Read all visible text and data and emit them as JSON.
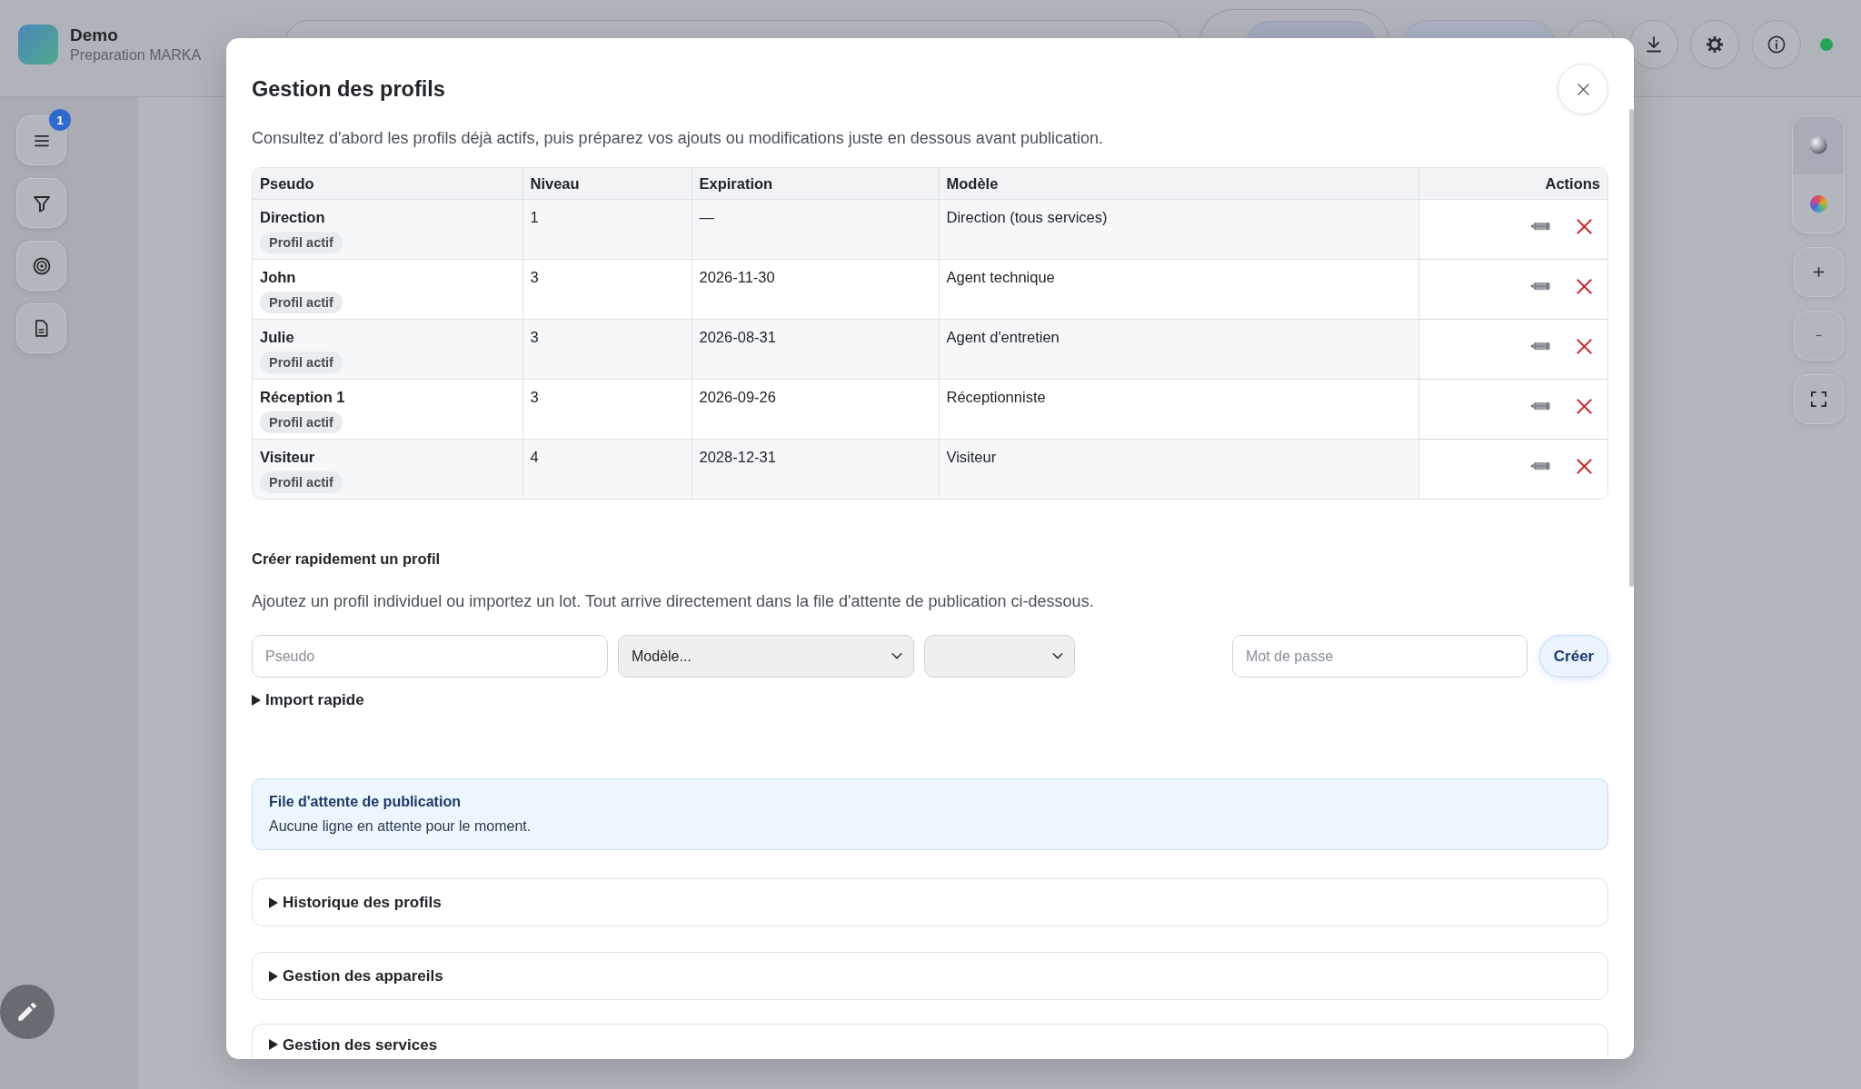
{
  "app": {
    "title": "Demo",
    "subtitle": "Preparation MARKA",
    "menu_badge": "1"
  },
  "connection": {
    "online": true
  },
  "map_layers": [
    {
      "kind": "sphere",
      "selected": true
    },
    {
      "kind": "color-wheel",
      "selected": false
    }
  ],
  "modal": {
    "title": "Gestion des profils",
    "intro": "Consultez d'abord les profils déjà actifs, puis préparez vos ajouts ou modifications juste en dessous avant publication.",
    "table": {
      "columns": [
        "Pseudo",
        "Niveau",
        "Expiration",
        "Modèle",
        "Actions"
      ],
      "rows": [
        {
          "pseudo": "Direction",
          "status": "Profil actif",
          "niveau": "1",
          "expiration": "—",
          "modele": "Direction (tous services)"
        },
        {
          "pseudo": "John",
          "status": "Profil actif",
          "niveau": "3",
          "expiration": "2026-11-30",
          "modele": "Agent technique"
        },
        {
          "pseudo": "Julie",
          "status": "Profil actif",
          "niveau": "3",
          "expiration": "2026-08-31",
          "modele": "Agent d'entretien"
        },
        {
          "pseudo": "Réception 1",
          "status": "Profil actif",
          "niveau": "3",
          "expiration": "2026-09-26",
          "modele": "Réceptionniste"
        },
        {
          "pseudo": "Visiteur",
          "status": "Profil actif",
          "niveau": "4",
          "expiration": "2028-12-31",
          "modele": "Visiteur"
        }
      ]
    },
    "quick_create": {
      "title": "Créer rapidement un profil",
      "description": "Ajoutez un profil individuel ou importez un lot. Tout arrive directement dans la file d'attente de publication ci-dessous.",
      "fields": [
        {
          "kind": "text",
          "placeholder": "Pseudo"
        },
        {
          "kind": "select",
          "value": "Modèle..."
        },
        {
          "kind": "select"
        },
        {
          "kind": "password",
          "placeholder": "Mot de passe"
        }
      ],
      "submit": "Créer",
      "import": {
        "label": "Import rapide",
        "expanded": false
      }
    },
    "queue": {
      "title": "File d'attente de publication",
      "message": "Aucune ligne en attente pour le moment."
    },
    "sections": [
      {
        "label": "Historique des profils",
        "expanded": false
      },
      {
        "label": "Gestion des appareils",
        "expanded": false
      },
      {
        "label": "Gestion des services",
        "expanded": false
      }
    ]
  }
}
